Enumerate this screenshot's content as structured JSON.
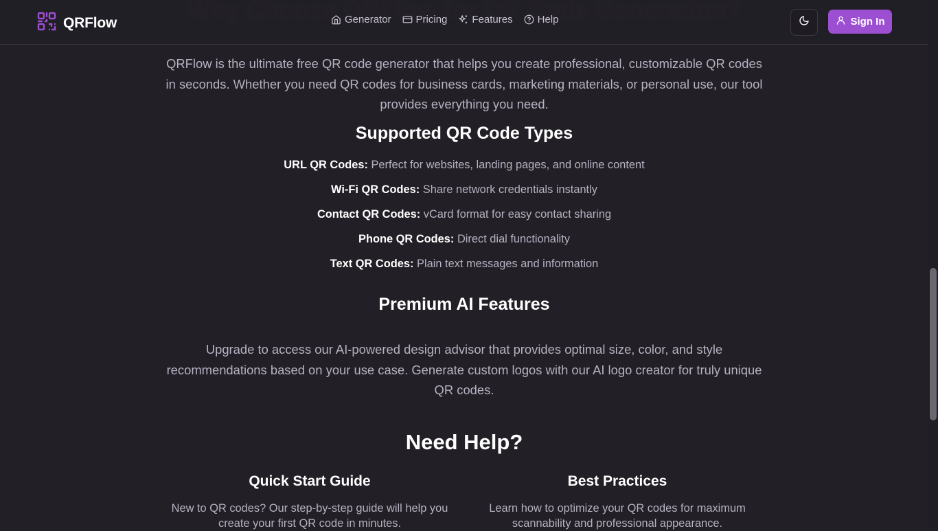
{
  "header": {
    "brand": "QRFlow",
    "nav": [
      {
        "label": "Generator",
        "icon": "home-icon"
      },
      {
        "label": "Pricing",
        "icon": "credit-card-icon"
      },
      {
        "label": "Features",
        "icon": "sparkles-icon"
      },
      {
        "label": "Help",
        "icon": "help-circle-icon"
      }
    ],
    "theme_icon": "moon-icon",
    "sign_in_label": "Sign In",
    "sign_in_icon": "user-icon",
    "accent_color": "#9d4fd2"
  },
  "about": {
    "heading": "Why Choose QRFlow for QR Code Generation?",
    "intro": "QRFlow is the ultimate free QR code generator that helps you create professional, customizable QR codes in seconds. Whether you need QR codes for business cards, marketing materials, or personal use, our tool provides everything you need."
  },
  "types": {
    "heading": "Supported QR Code Types",
    "items": [
      {
        "label": "URL QR Codes:",
        "desc": "Perfect for websites, landing pages, and online content"
      },
      {
        "label": "Wi-Fi QR Codes:",
        "desc": "Share network credentials instantly"
      },
      {
        "label": "Contact QR Codes:",
        "desc": "vCard format for easy contact sharing"
      },
      {
        "label": "Phone QR Codes:",
        "desc": "Direct dial functionality"
      },
      {
        "label": "Text QR Codes:",
        "desc": "Plain text messages and information"
      }
    ]
  },
  "premium": {
    "heading": "Premium AI Features",
    "text": "Upgrade to access our AI-powered design advisor that provides optimal size, color, and style recommendations based on your use case. Generate custom logos with our AI logo creator for truly unique QR codes."
  },
  "help": {
    "heading": "Need Help?",
    "cards": [
      {
        "title": "Quick Start Guide",
        "text": "New to QR codes? Our step-by-step guide will help you create your first QR code in minutes."
      },
      {
        "title": "Best Practices",
        "text": "Learn how to optimize your QR codes for maximum scannability and professional appearance."
      }
    ]
  }
}
